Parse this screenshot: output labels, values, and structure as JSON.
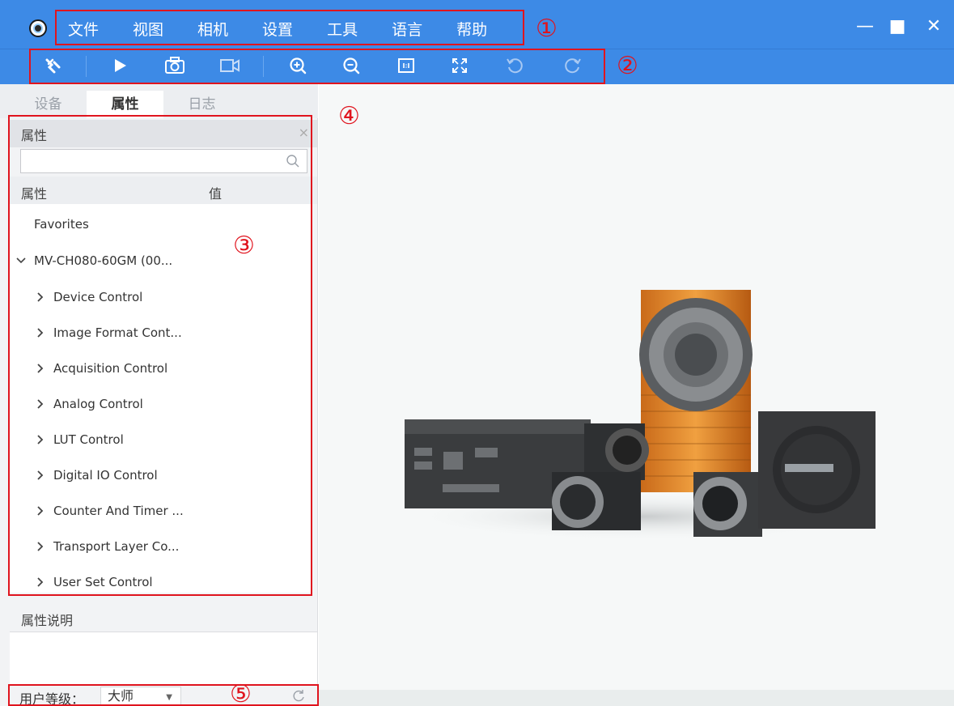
{
  "menu": {
    "items": [
      "文件",
      "视图",
      "相机",
      "设置",
      "工具",
      "语言",
      "帮助"
    ]
  },
  "window": {
    "minimize": "—",
    "maximize": "■",
    "close": "✕"
  },
  "toolbar": {
    "buttons": [
      "disconnect-icon",
      "play-icon",
      "camera-icon",
      "record-icon",
      "zoom-in-icon",
      "zoom-out-icon",
      "actual-size-icon",
      "fit-window-icon",
      "rotate-left-icon",
      "rotate-right-icon"
    ]
  },
  "annotations": [
    "①",
    "②",
    "③",
    "④",
    "⑤"
  ],
  "tabs": [
    "设备",
    "属性",
    "日志"
  ],
  "properties": {
    "title": "属性",
    "close": "×",
    "search": {
      "value": "",
      "placeholder": ""
    },
    "columns": {
      "property": "属性",
      "value": "值"
    },
    "tree": [
      {
        "label": "Favorites",
        "level": 0,
        "expand": "none"
      },
      {
        "label": "MV-CH080-60GM (00...",
        "level": 0,
        "expand": "expanded"
      },
      {
        "label": "Device Control",
        "level": 1,
        "expand": "collapsed"
      },
      {
        "label": "Image Format Cont...",
        "level": 1,
        "expand": "collapsed"
      },
      {
        "label": "Acquisition Control",
        "level": 1,
        "expand": "collapsed"
      },
      {
        "label": "Analog Control",
        "level": 1,
        "expand": "collapsed"
      },
      {
        "label": "LUT Control",
        "level": 1,
        "expand": "collapsed"
      },
      {
        "label": "Digital IO Control",
        "level": 1,
        "expand": "collapsed"
      },
      {
        "label": "Counter And Timer ...",
        "level": 1,
        "expand": "collapsed"
      },
      {
        "label": "Transport Layer Co...",
        "level": 1,
        "expand": "collapsed"
      },
      {
        "label": "User Set Control",
        "level": 1,
        "expand": "collapsed"
      }
    ]
  },
  "description": {
    "title": "属性说明"
  },
  "user_level": {
    "label": "用户等级：",
    "value": "大师"
  },
  "colors": {
    "titlebar": "#3d8ae6",
    "annotation": "#e0141e",
    "camera_orange": "#e98a2a"
  }
}
